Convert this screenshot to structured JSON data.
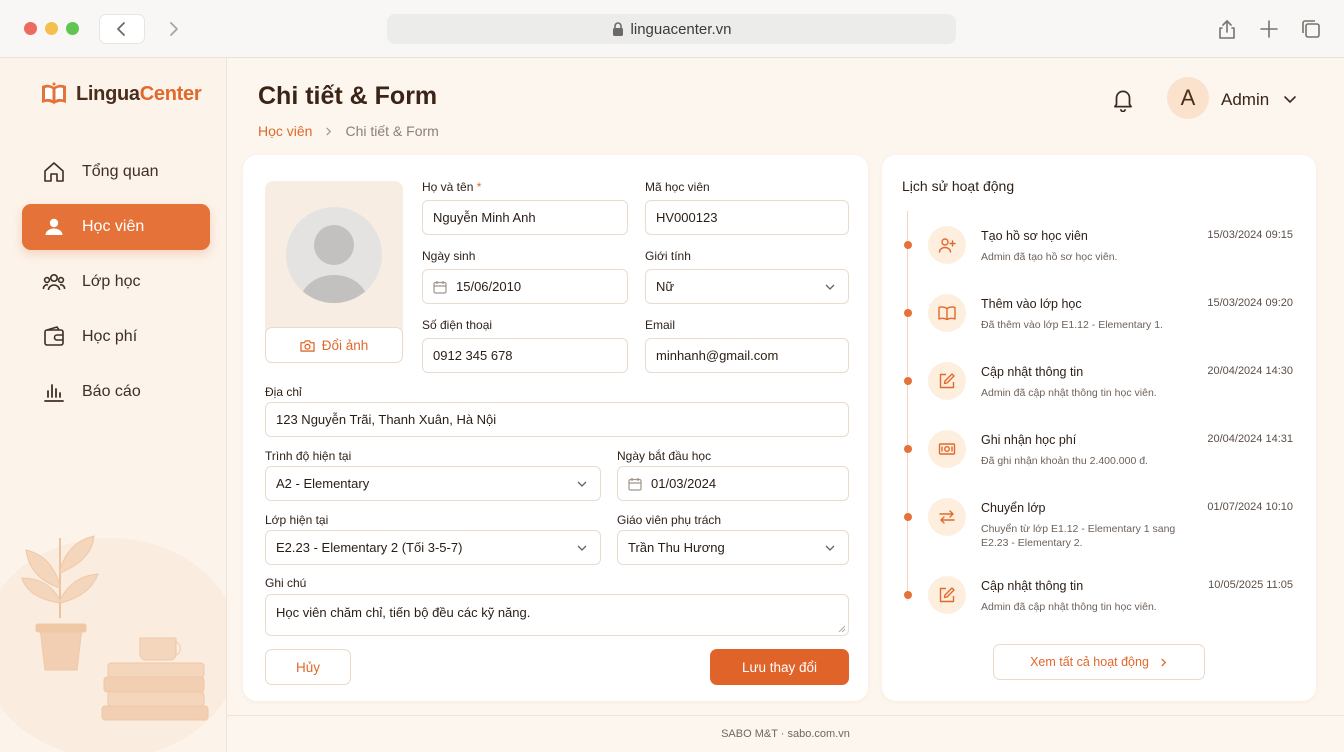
{
  "browser": {
    "url": "linguacenter.vn"
  },
  "app": {
    "logo_part1": "Lingua",
    "logo_part2": "Center",
    "accent": "#e57238"
  },
  "sidebar": {
    "items": [
      {
        "label": "Tổng quan",
        "icon": "home-icon",
        "active": false
      },
      {
        "label": "Học viên",
        "icon": "user-icon",
        "active": true
      },
      {
        "label": "Lớp học",
        "icon": "users-icon",
        "active": false
      },
      {
        "label": "Học phí",
        "icon": "wallet-icon",
        "active": false
      },
      {
        "label": "Báo cáo",
        "icon": "bar-chart-icon",
        "active": false
      }
    ]
  },
  "header": {
    "title": "Chi tiết & Form",
    "breadcrumb": {
      "link": "Học viên",
      "sep": ">",
      "current": "Chi tiết & Form"
    },
    "user": {
      "initial": "A",
      "name": "Admin"
    }
  },
  "form": {
    "change_photo": "Đổi ảnh",
    "full_name": {
      "label": "Họ và tên",
      "required": "*",
      "value": "Nguyễn Minh Anh"
    },
    "student_id": {
      "label": "Mã học viên",
      "value": "HV000123"
    },
    "birthday": {
      "label": "Ngày sinh",
      "value": "15/06/2010"
    },
    "gender": {
      "label": "Giới tính",
      "value": "Nữ"
    },
    "phone": {
      "label": "Số điện thoại",
      "value": "0912 345 678"
    },
    "email": {
      "label": "Email",
      "value": "minhanh@gmail.com"
    },
    "address": {
      "label": "Địa chỉ",
      "value": "123 Nguyễn Trãi, Thanh Xuân, Hà Nội"
    },
    "level": {
      "label": "Trình độ hiện tại",
      "value": "A2 - Elementary"
    },
    "start_date": {
      "label": "Ngày bắt đầu học",
      "value": "01/03/2024"
    },
    "current_class": {
      "label": "Lớp hiện tại",
      "value": "E2.23 - Elementary 2 (Tối 3-5-7)"
    },
    "teacher": {
      "label": "Giáo viên phụ trách",
      "value": "Trần Thu Hương"
    },
    "notes": {
      "label": "Ghi chú",
      "value": "Học viên chăm chỉ, tiến bộ đều các kỹ năng."
    },
    "cancel": "Hủy",
    "save": "Lưu thay đổi"
  },
  "activity": {
    "title": "Lịch sử hoạt động",
    "items": [
      {
        "title": "Tạo hồ sơ học viên",
        "time": "15/03/2024 09:15",
        "desc": "Admin đã tạo hồ sơ học viên.",
        "icon": "user-plus-icon"
      },
      {
        "title": "Thêm vào lớp học",
        "time": "15/03/2024 09:20",
        "desc": "Đã thêm vào lớp E1.12 - Elementary 1.",
        "icon": "book-open-icon"
      },
      {
        "title": "Cập nhật thông tin",
        "time": "20/04/2024 14:30",
        "desc": "Admin đã cập nhật thông tin học viên.",
        "icon": "edit-icon"
      },
      {
        "title": "Ghi nhận học phí",
        "time": "20/04/2024 14:31",
        "desc": "Đã ghi nhận khoản thu 2.400.000 đ.",
        "icon": "money-icon"
      },
      {
        "title": "Chuyển lớp",
        "time": "01/07/2024 10:10",
        "desc": "Chuyển từ lớp E1.12 - Elementary 1 sang E2.23 - Elementary 2.",
        "icon": "swap-icon"
      },
      {
        "title": "Cập nhật thông tin",
        "time": "10/05/2025 11:05",
        "desc": "Admin đã cập nhật thông tin học viên.",
        "icon": "edit-icon"
      }
    ],
    "view_all": "Xem tất cả hoạt động"
  },
  "footer": {
    "text": "SABO M&T · sabo.com.vn"
  }
}
